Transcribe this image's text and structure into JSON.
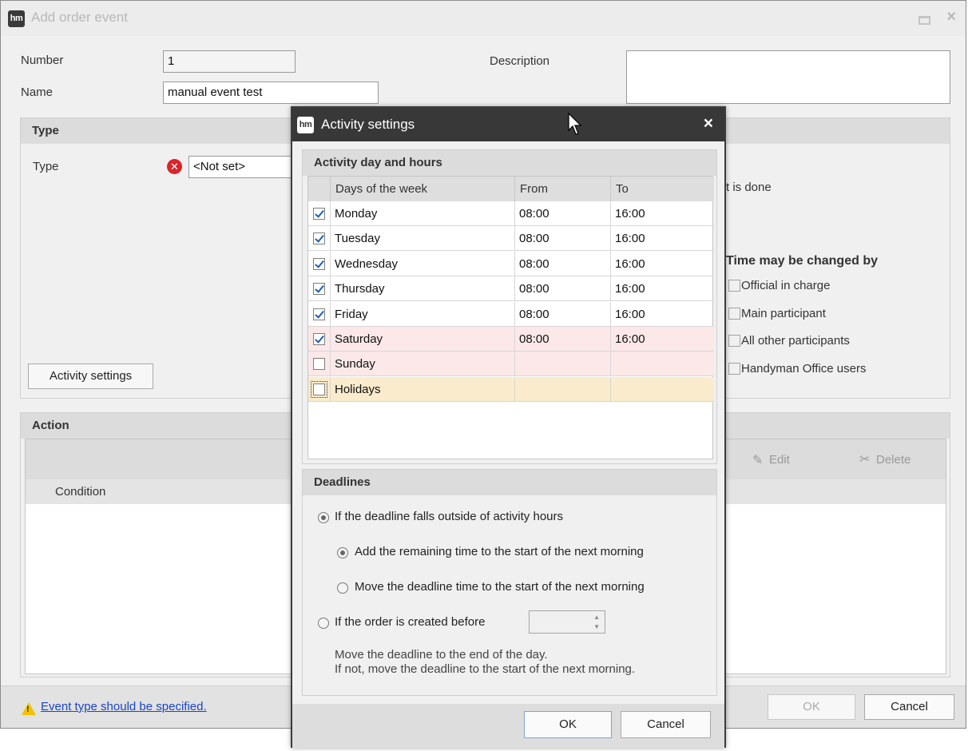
{
  "main": {
    "title": "Add order event",
    "number_label": "Number",
    "number_value": "1",
    "name_label": "Name",
    "name_value": "manual event test",
    "description_label": "Description",
    "type_group_title": "Type",
    "type_label": "Type",
    "type_value": "<Not set>",
    "partial_text": "t is done",
    "time_changed_by_title": "Time may be changed by",
    "time_changed_options": [
      "Official in charge",
      "Main participant",
      "All other participants",
      "Handyman Office users"
    ],
    "activity_settings_button": "Activity settings",
    "action_group_title": "Action",
    "edit_label": "Edit",
    "delete_label": "Delete",
    "condition_header": "Condition",
    "warning_text": "Event type should be specified.",
    "ok_label": "OK",
    "cancel_label": "Cancel"
  },
  "dialog": {
    "title": "Activity settings",
    "activity_group_title": "Activity day and hours",
    "columns": [
      "Days of the week",
      "From",
      "To"
    ],
    "rows": [
      {
        "day": "Monday",
        "from": "08:00",
        "to": "16:00",
        "checked": true
      },
      {
        "day": "Tuesday",
        "from": "08:00",
        "to": "16:00",
        "checked": true
      },
      {
        "day": "Wednesday",
        "from": "08:00",
        "to": "16:00",
        "checked": true
      },
      {
        "day": "Thursday",
        "from": "08:00",
        "to": "16:00",
        "checked": true
      },
      {
        "day": "Friday",
        "from": "08:00",
        "to": "16:00",
        "checked": true
      },
      {
        "day": "Saturday",
        "from": "08:00",
        "to": "16:00",
        "checked": true
      },
      {
        "day": "Sunday",
        "from": "",
        "to": "",
        "checked": false
      },
      {
        "day": "Holidays",
        "from": "",
        "to": "",
        "checked": false
      }
    ],
    "deadlines_title": "Deadlines",
    "outside_hours_label": "If the deadline falls outside of activity hours",
    "add_remaining_label": "Add the remaining time to the start of the next morning",
    "move_deadline_label": "Move the deadline time to the start of the next morning",
    "created_before_label": "If the order is created before",
    "created_before_value": "",
    "note_line1": "Move the deadline to the end of the day.",
    "note_line2": "If not, move the deadline to the start of the next morning.",
    "ok_label": "OK",
    "cancel_label": "Cancel"
  },
  "colors": {
    "weekend_row": "#fce8e8",
    "holiday_row": "#faebcc",
    "dialog_titlebar": "#383838",
    "link": "#1a45c8"
  }
}
